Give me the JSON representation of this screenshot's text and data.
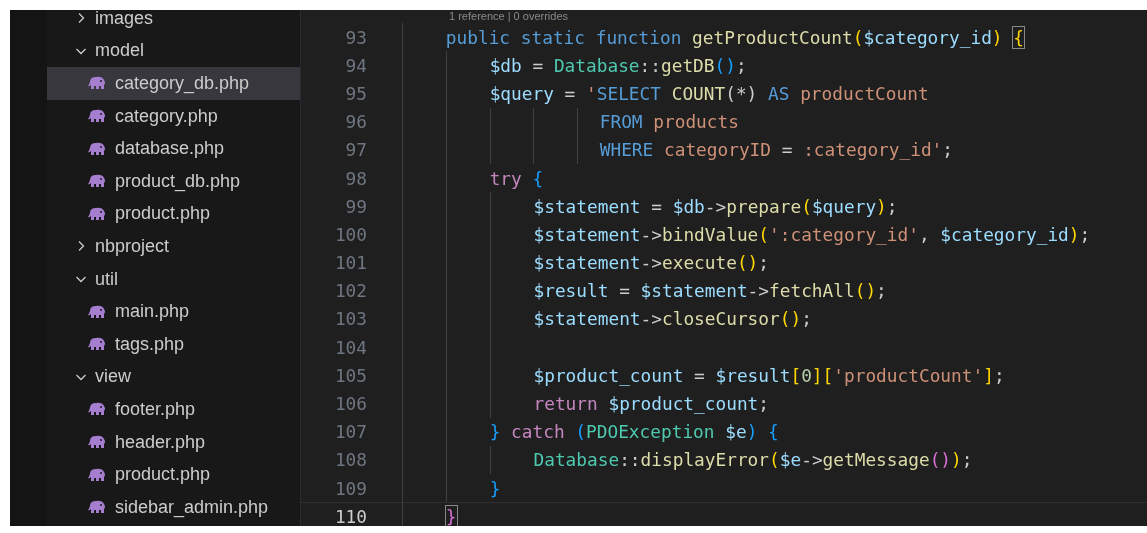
{
  "explorer": {
    "tree": [
      {
        "kind": "folder",
        "name": "images",
        "expanded": false
      },
      {
        "kind": "folder",
        "name": "model",
        "expanded": true,
        "children": [
          {
            "kind": "file",
            "name": "category_db.php",
            "selected": true
          },
          {
            "kind": "file",
            "name": "category.php",
            "selected": false
          },
          {
            "kind": "file",
            "name": "database.php",
            "selected": false
          },
          {
            "kind": "file",
            "name": "product_db.php",
            "selected": false
          },
          {
            "kind": "file",
            "name": "product.php",
            "selected": false
          }
        ]
      },
      {
        "kind": "folder",
        "name": "nbproject",
        "expanded": false
      },
      {
        "kind": "folder",
        "name": "util",
        "expanded": true,
        "children": [
          {
            "kind": "file",
            "name": "main.php",
            "selected": false
          },
          {
            "kind": "file",
            "name": "tags.php",
            "selected": false
          }
        ]
      },
      {
        "kind": "folder",
        "name": "view",
        "expanded": true,
        "children": [
          {
            "kind": "file",
            "name": "footer.php",
            "selected": false
          },
          {
            "kind": "file",
            "name": "header.php",
            "selected": false
          },
          {
            "kind": "file",
            "name": "product.php",
            "selected": false
          },
          {
            "kind": "file",
            "name": "sidebar_admin.php",
            "selected": false
          }
        ]
      }
    ]
  },
  "editor": {
    "codelens": "1 reference | 0 overrides",
    "lines": [
      {
        "number": "93",
        "current": false,
        "tokens": [
          {
            "kind": "kw",
            "text": "    public static function "
          },
          {
            "kind": "fn",
            "text": "getProductCount"
          },
          {
            "kind": "br1",
            "text": "("
          },
          {
            "kind": "var",
            "text": "$category_id"
          },
          {
            "kind": "br1",
            "text": ") "
          },
          {
            "kind": "br1",
            "text": "{",
            "matched": true
          }
        ]
      },
      {
        "number": "94",
        "current": false,
        "tokens": [
          {
            "kind": "var",
            "text": "        $db"
          },
          {
            "kind": "plain",
            "text": " = "
          },
          {
            "kind": "cls",
            "text": "Database"
          },
          {
            "kind": "plain",
            "text": "::"
          },
          {
            "kind": "fn",
            "text": "getDB"
          },
          {
            "kind": "br3",
            "text": "()"
          },
          {
            "kind": "plain",
            "text": ";"
          }
        ]
      },
      {
        "number": "95",
        "current": false,
        "tokens": [
          {
            "kind": "var",
            "text": "        $query"
          },
          {
            "kind": "plain",
            "text": " = "
          },
          {
            "kind": "str",
            "text": "'"
          },
          {
            "kind": "sqlkw",
            "text": "SELECT "
          },
          {
            "kind": "fn",
            "text": "COUNT"
          },
          {
            "kind": "plain",
            "text": "(*) "
          },
          {
            "kind": "sqlkw",
            "text": "AS"
          },
          {
            "kind": "str",
            "text": " productCount"
          }
        ]
      },
      {
        "number": "96",
        "current": false,
        "tokens": [
          {
            "kind": "sqlkw",
            "text": "                  FROM"
          },
          {
            "kind": "str",
            "text": " products"
          }
        ]
      },
      {
        "number": "97",
        "current": false,
        "tokens": [
          {
            "kind": "sqlkw",
            "text": "                  WHERE"
          },
          {
            "kind": "str",
            "text": " categoryID "
          },
          {
            "kind": "plain",
            "text": "="
          },
          {
            "kind": "str",
            "text": " :category_id'"
          },
          {
            "kind": "plain",
            "text": ";"
          }
        ]
      },
      {
        "number": "98",
        "current": false,
        "tokens": [
          {
            "kind": "ctrl",
            "text": "        try "
          },
          {
            "kind": "br3",
            "text": "{"
          }
        ]
      },
      {
        "number": "99",
        "current": false,
        "tokens": [
          {
            "kind": "var",
            "text": "            $statement"
          },
          {
            "kind": "plain",
            "text": " = "
          },
          {
            "kind": "var",
            "text": "$db"
          },
          {
            "kind": "plain",
            "text": "->"
          },
          {
            "kind": "fn",
            "text": "prepare"
          },
          {
            "kind": "br1",
            "text": "("
          },
          {
            "kind": "var",
            "text": "$query"
          },
          {
            "kind": "br1",
            "text": ")"
          },
          {
            "kind": "plain",
            "text": ";"
          }
        ]
      },
      {
        "number": "100",
        "current": false,
        "tokens": [
          {
            "kind": "var",
            "text": "            $statement"
          },
          {
            "kind": "plain",
            "text": "->"
          },
          {
            "kind": "fn",
            "text": "bindValue"
          },
          {
            "kind": "br1",
            "text": "("
          },
          {
            "kind": "str",
            "text": "':category_id'"
          },
          {
            "kind": "plain",
            "text": ", "
          },
          {
            "kind": "var",
            "text": "$category_id"
          },
          {
            "kind": "br1",
            "text": ")"
          },
          {
            "kind": "plain",
            "text": ";"
          }
        ]
      },
      {
        "number": "101",
        "current": false,
        "tokens": [
          {
            "kind": "var",
            "text": "            $statement"
          },
          {
            "kind": "plain",
            "text": "->"
          },
          {
            "kind": "fn",
            "text": "execute"
          },
          {
            "kind": "br1",
            "text": "()"
          },
          {
            "kind": "plain",
            "text": ";"
          }
        ]
      },
      {
        "number": "102",
        "current": false,
        "tokens": [
          {
            "kind": "var",
            "text": "            $result"
          },
          {
            "kind": "plain",
            "text": " = "
          },
          {
            "kind": "var",
            "text": "$statement"
          },
          {
            "kind": "plain",
            "text": "->"
          },
          {
            "kind": "fn",
            "text": "fetchAll"
          },
          {
            "kind": "br1",
            "text": "()"
          },
          {
            "kind": "plain",
            "text": ";"
          }
        ]
      },
      {
        "number": "103",
        "current": false,
        "tokens": [
          {
            "kind": "var",
            "text": "            $statement"
          },
          {
            "kind": "plain",
            "text": "->"
          },
          {
            "kind": "fn",
            "text": "closeCursor"
          },
          {
            "kind": "br1",
            "text": "()"
          },
          {
            "kind": "plain",
            "text": ";"
          }
        ]
      },
      {
        "number": "104",
        "current": false
      },
      {
        "number": "105",
        "current": false,
        "tokens": [
          {
            "kind": "var",
            "text": "            $product_count"
          },
          {
            "kind": "plain",
            "text": " = "
          },
          {
            "kind": "var",
            "text": "$result"
          },
          {
            "kind": "br1",
            "text": "["
          },
          {
            "kind": "num",
            "text": "0"
          },
          {
            "kind": "br1",
            "text": "]["
          },
          {
            "kind": "str",
            "text": "'productCount'"
          },
          {
            "kind": "br1",
            "text": "]"
          },
          {
            "kind": "plain",
            "text": ";"
          }
        ]
      },
      {
        "number": "106",
        "current": false,
        "tokens": [
          {
            "kind": "ctrl",
            "text": "            return "
          },
          {
            "kind": "var",
            "text": "$product_count"
          },
          {
            "kind": "plain",
            "text": ";"
          }
        ]
      },
      {
        "number": "107",
        "current": false,
        "tokens": [
          {
            "kind": "br3",
            "text": "        }"
          },
          {
            "kind": "ctrl",
            "text": " catch "
          },
          {
            "kind": "br3",
            "text": "("
          },
          {
            "kind": "cls",
            "text": "PDOException "
          },
          {
            "kind": "var",
            "text": "$e"
          },
          {
            "kind": "br3",
            "text": ")"
          },
          {
            "kind": "br3",
            "text": " {"
          }
        ]
      },
      {
        "number": "108",
        "current": false,
        "tokens": [
          {
            "kind": "cls",
            "text": "            Database"
          },
          {
            "kind": "plain",
            "text": "::"
          },
          {
            "kind": "fn",
            "text": "displayError"
          },
          {
            "kind": "br1",
            "text": "("
          },
          {
            "kind": "var",
            "text": "$e"
          },
          {
            "kind": "plain",
            "text": "->"
          },
          {
            "kind": "fn",
            "text": "getMessage"
          },
          {
            "kind": "br2",
            "text": "()"
          },
          {
            "kind": "br1",
            "text": ")"
          },
          {
            "kind": "plain",
            "text": ";"
          }
        ]
      },
      {
        "number": "109",
        "current": false,
        "tokens": [
          {
            "kind": "br3",
            "text": "        }"
          }
        ]
      },
      {
        "number": "110",
        "current": true,
        "tokens": [
          {
            "kind": "br2",
            "text": "    }",
            "matched": true
          }
        ]
      }
    ]
  }
}
